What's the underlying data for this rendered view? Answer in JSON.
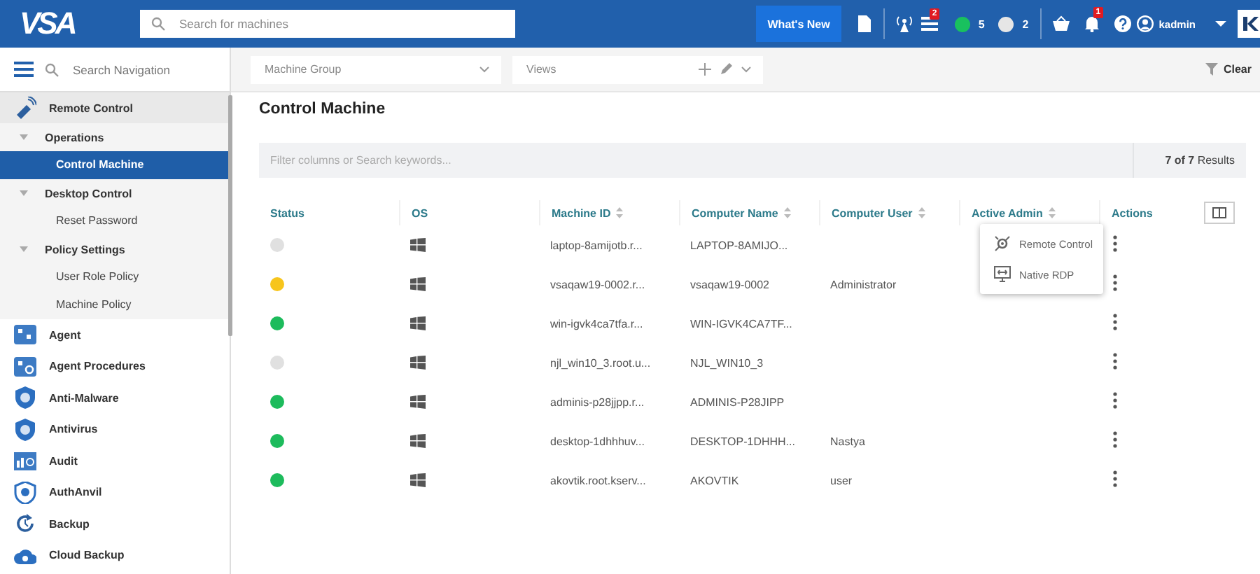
{
  "topbar": {
    "logo": "VSA",
    "search": {
      "placeholder": "Search for machines"
    },
    "whats_new": "What's New",
    "tasks_badge": "2",
    "online_count": "5",
    "offline_count": "2",
    "notifications_badge": "1",
    "user": "kadmin"
  },
  "nav_search": {
    "placeholder": "Search Navigation"
  },
  "sidebar": {
    "items": [
      {
        "label": "Remote Control",
        "kind": "module",
        "expanded": true,
        "children": [
          {
            "label": "Operations",
            "kind": "folder",
            "expanded": true,
            "children": [
              {
                "label": "Control Machine",
                "kind": "page",
                "selected": true
              }
            ]
          },
          {
            "label": "Desktop Control",
            "kind": "folder",
            "expanded": true,
            "children": [
              {
                "label": "Reset Password",
                "kind": "page",
                "selected": false
              }
            ]
          },
          {
            "label": "Policy Settings",
            "kind": "folder",
            "expanded": true,
            "children": [
              {
                "label": "User Role Policy",
                "kind": "page",
                "selected": false
              },
              {
                "label": "Machine Policy",
                "kind": "page",
                "selected": false
              }
            ]
          }
        ]
      },
      {
        "label": "Agent",
        "kind": "module",
        "expanded": false
      },
      {
        "label": "Agent Procedures",
        "kind": "module",
        "expanded": false
      },
      {
        "label": "Anti-Malware",
        "kind": "module",
        "expanded": false
      },
      {
        "label": "Antivirus",
        "kind": "module",
        "expanded": false
      },
      {
        "label": "Audit",
        "kind": "module",
        "expanded": false
      },
      {
        "label": "AuthAnvil",
        "kind": "module",
        "expanded": false
      },
      {
        "label": "Backup",
        "kind": "module",
        "expanded": false
      },
      {
        "label": "Cloud Backup",
        "kind": "module",
        "expanded": false
      }
    ]
  },
  "toolbar": {
    "machine_group": {
      "placeholder": "Machine Group"
    },
    "views": {
      "placeholder": "Views"
    },
    "clear": "Clear"
  },
  "page_title": "Control Machine",
  "table": {
    "filter": {
      "placeholder": "Filter columns or Search keywords..."
    },
    "results": "**7 of 7** Results",
    "columns": [
      {
        "label": "Status",
        "sortable": false
      },
      {
        "label": "OS",
        "sortable": false
      },
      {
        "label": "Machine ID",
        "sortable": true
      },
      {
        "label": "Computer Name",
        "sortable": true
      },
      {
        "label": "Computer User",
        "sortable": true
      },
      {
        "label": "Active Admin",
        "sortable": true
      },
      {
        "label": "Actions",
        "sortable": false
      }
    ],
    "rows": [
      {
        "color": "#e0e0e0",
        "machine_id": "laptop-8amijotb.r...",
        "computer_name": "LAPTOP-8AMIJO..."
      },
      {
        "color": "#f7c51c",
        "machine_id": "vsaqaw19-0002.r...",
        "computer_name": "vsaqaw19-0002",
        "computer_user": "Administrator"
      },
      {
        "color": "#1dbb5c",
        "machine_id": "win-igvk4ca7tfa.r...",
        "computer_name": "WIN-IGVK4CA7TF..."
      },
      {
        "color": "#e0e0e0",
        "machine_id": "njl_win10_3.root.u...",
        "computer_name": "NJL_WIN10_3"
      },
      {
        "color": "#1dbb5c",
        "machine_id": "adminis-p28jjpp.r...",
        "computer_name": "ADMINIS-P28JIPP"
      },
      {
        "color": "#1dbb5c",
        "machine_id": "desktop-1dhhhuv...",
        "computer_name": "DESKTOP-1DHHH...",
        "computer_user": "Nastya"
      },
      {
        "color": "#1dbb5c",
        "machine_id": "akovtik.root.kserv...",
        "computer_name": "AKOVTIK",
        "computer_user": "user"
      }
    ]
  },
  "action_menu": {
    "items": [
      {
        "label": "Remote Control"
      },
      {
        "label": "Native RDP"
      }
    ]
  }
}
